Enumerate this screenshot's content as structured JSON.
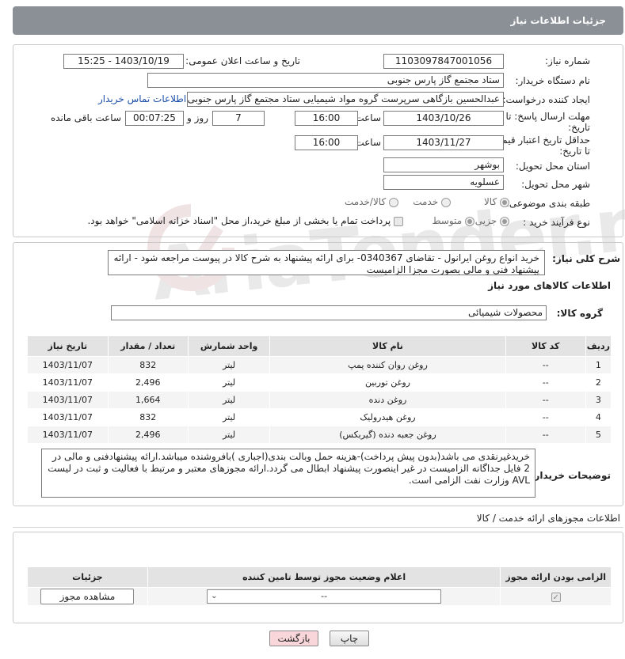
{
  "header": {
    "title": "جزئیات اطلاعات نیاز"
  },
  "form": {
    "need_number": {
      "label": "شماره نیاز:",
      "value": "1103097847001056"
    },
    "announce_datetime": {
      "label": "تاریخ و ساعت اعلان عمومی:",
      "value": "1403/10/19 - 15:25"
    },
    "buyer_org": {
      "label": "نام دستگاه خریدار:",
      "value": "ستاد مجتمع گاز پارس جنوبی"
    },
    "requester": {
      "label": "ایجاد کننده درخواست:",
      "value": "عبدالحسین بازگاهی سرپرست گروه مواد شیمیایی ستاد مجتمع گاز پارس جنوبی",
      "contact_link": "اطلاعات تماس خریدار"
    },
    "deadline": {
      "label": "مهلت ارسال پاسخ: تا تاریخ:",
      "date": "1403/10/26",
      "time_label": "ساعت",
      "time": "16:00",
      "days": "7",
      "days_label": "روز و",
      "remaining": "00:07:25",
      "remaining_label": "ساعت باقی مانده"
    },
    "price_validity": {
      "label": "حداقل تاریخ اعتبار قیمت: تا تاریخ:",
      "date": "1403/11/27",
      "time_label": "ساعت",
      "time": "16:00"
    },
    "province": {
      "label": "استان محل تحویل:",
      "value": "بوشهر"
    },
    "city": {
      "label": "شهر محل تحویل:",
      "value": "عسلویه"
    },
    "category": {
      "label": "طبقه بندی موضوعی:",
      "options": [
        "کالا",
        "خدمت",
        "کالا/خدمت"
      ]
    },
    "purchase_type": {
      "label": "نوع فرآیند خرید :",
      "options": [
        "جزیی",
        "متوسط"
      ],
      "payment_text": "پرداخت تمام یا بخشی از مبلغ خرید،از محل \"اسناد خزانه اسلامی\" خواهد بود."
    }
  },
  "description": {
    "label": "شرح کلی نیاز:",
    "text": "خرید انواع روغن ایرانول - تقاضای 0340367- برای ارائه پیشنهاد به شرح کالا در پیوست مراجعه شود - ارائه پیشنهاد فنی و مالی بصورت مجزا الزامیست"
  },
  "goods": {
    "section_title": "اطلاعات کالاهای مورد نیاز",
    "group_label": "گروه کالا:",
    "group_value": "محصولات شیمیائی",
    "columns": [
      "ردیف",
      "کد کالا",
      "نام کالا",
      "واحد شمارش",
      "تعداد / مقدار",
      "تاریخ نیاز"
    ],
    "rows": [
      [
        "1",
        "--",
        "روغن روان کننده پمپ",
        "لیتر",
        "832",
        "1403/11/07"
      ],
      [
        "2",
        "--",
        "روغن توربین",
        "لیتر",
        "2,496",
        "1403/11/07"
      ],
      [
        "3",
        "--",
        "روغن دنده",
        "لیتر",
        "1,664",
        "1403/11/07"
      ],
      [
        "4",
        "--",
        "روغن هیدرولیک",
        "لیتر",
        "832",
        "1403/11/07"
      ],
      [
        "5",
        "--",
        "روغن جعبه دنده (گیربکس)",
        "لیتر",
        "2,496",
        "1403/11/07"
      ]
    ]
  },
  "buyer_notes": {
    "label": "توضیحات خریدار:",
    "text": "خریدغیرنقدی می باشد(بدون پیش پرداخت)-هزینه حمل وبالت بندی(اجباری )بافروشنده میباشد.ارائه پیشنهادفنی و مالی در 2 فایل جداگانه الزامیست در غیر اینصورت پیشنهاد ابطال می گردد.ارائه مجوزهای معتبر و مرتبط با فعالیت و ثبت در لیست AVL وزارت نفت الزامی است."
  },
  "permits": {
    "section_title": "اطلاعات مجوزهای ارائه خدمت / کالا",
    "columns": [
      "الزامی بودن ارائه مجوز",
      "اعلام وضعیت مجوز توسط تامین کننده",
      "جزئیات"
    ],
    "select_value": "--",
    "view_button": "مشاهده مجوز"
  },
  "footer": {
    "print_button": "چاپ",
    "back_button": "بازگشت"
  },
  "watermark": {
    "text": "AriaTender.neT"
  },
  "colors": {
    "header_bg": "#8b9096",
    "link": "#1a4fa8",
    "back_button_bg": "#f9d6da"
  }
}
